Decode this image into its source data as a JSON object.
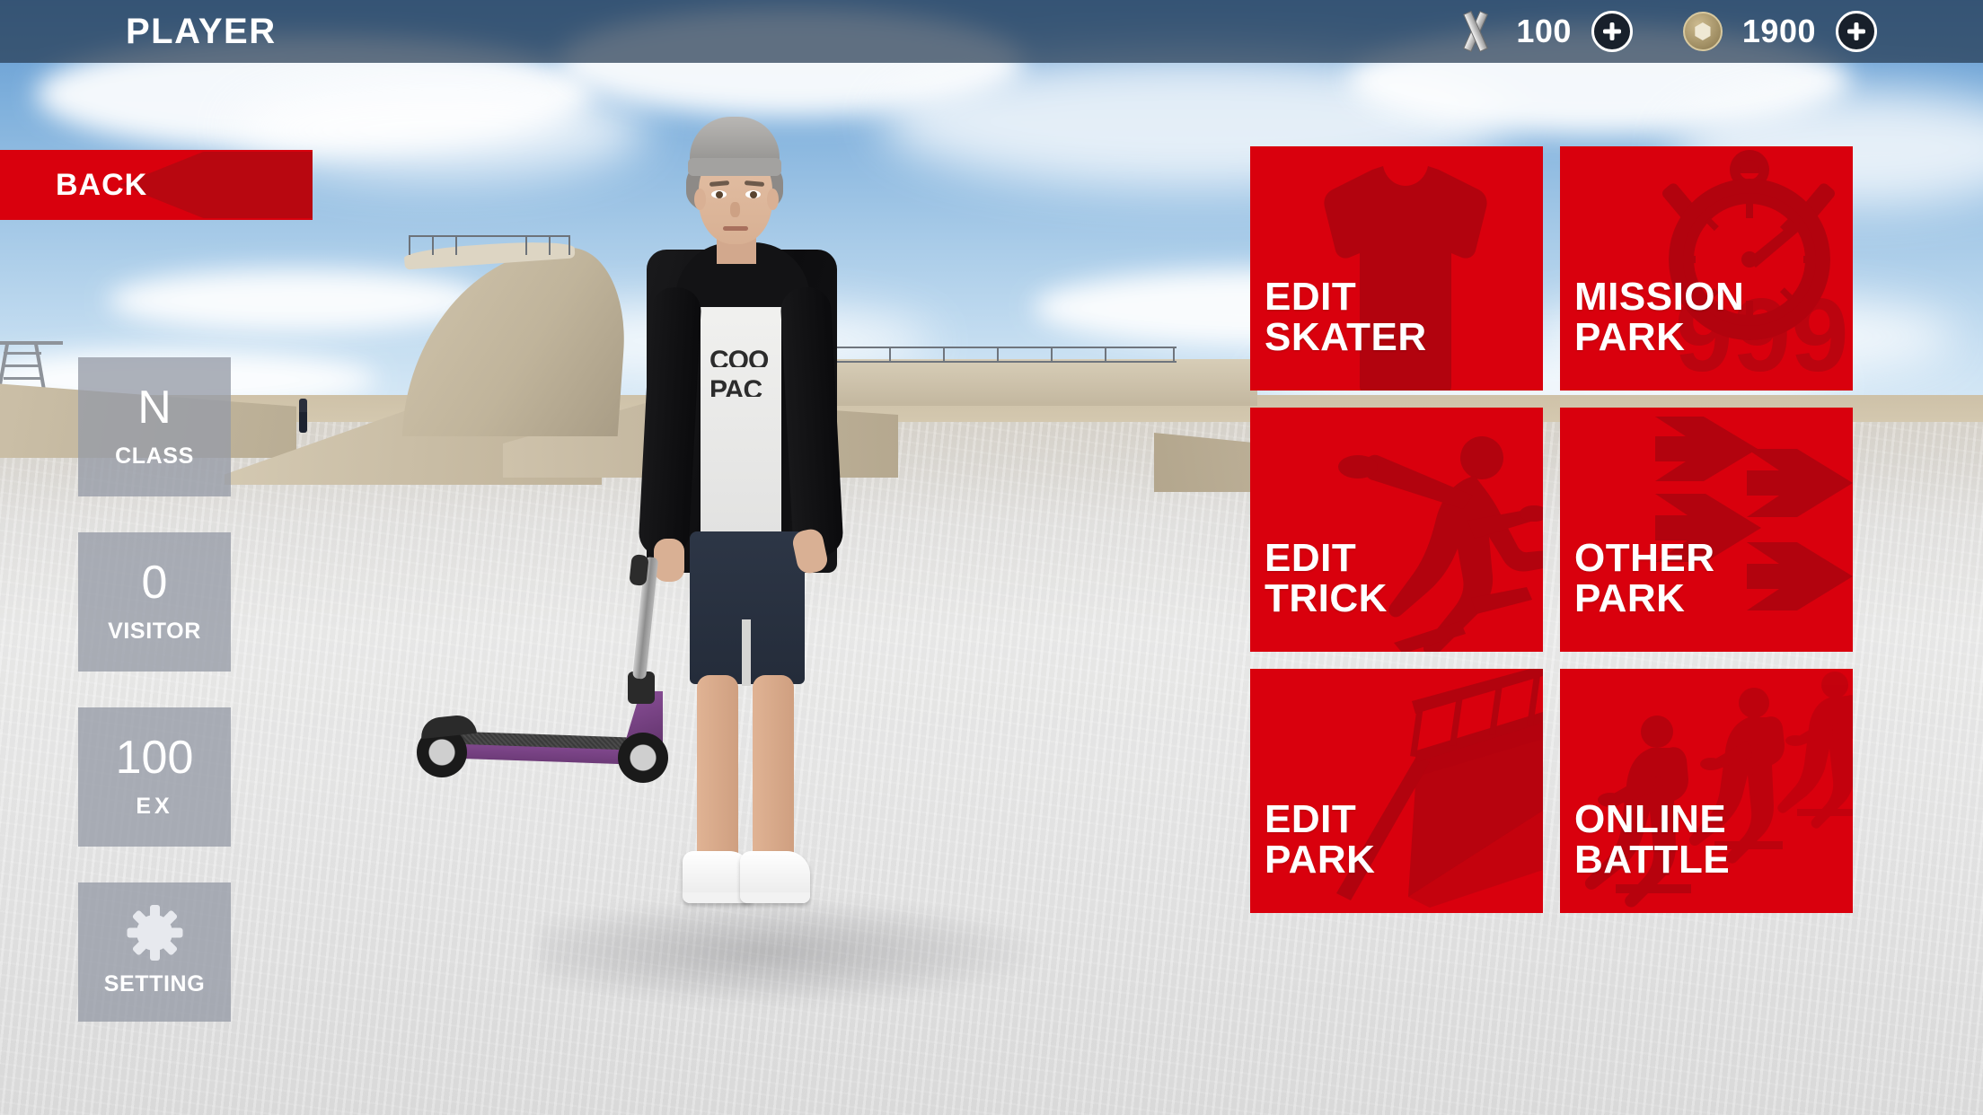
{
  "header": {
    "title": "PLAYER",
    "currencies": [
      {
        "icon": "x-token-icon",
        "value": "100",
        "add_label": "+"
      },
      {
        "icon": "gold-coin-icon",
        "value": "1900",
        "add_label": "+"
      }
    ]
  },
  "back_button": {
    "label": "BACK",
    "icon": "left-arrow-icon"
  },
  "stats": [
    {
      "value": "N",
      "caption": "CLASS",
      "spaced": false,
      "icon": null
    },
    {
      "value": "0",
      "caption": "VISITOR",
      "spaced": false,
      "icon": null
    },
    {
      "value": "100",
      "caption": "EX",
      "spaced": true,
      "icon": null
    },
    {
      "value": "",
      "caption": "SETTING",
      "spaced": false,
      "icon": "gear-icon"
    }
  ],
  "menu": {
    "tiles": [
      {
        "line1": "EDIT",
        "line2": "SKATER",
        "icon": "tshirt-icon"
      },
      {
        "line1": "MISSION",
        "line2": "PARK",
        "icon": "stopwatch-icon",
        "badge": "999"
      },
      {
        "line1": "EDIT",
        "line2": "TRICK",
        "icon": "skater-figure-icon"
      },
      {
        "line1": "OTHER",
        "line2": "PARK",
        "icon": "arrows-right-icon"
      },
      {
        "line1": "EDIT",
        "line2": "PARK",
        "icon": "ramp-icon"
      },
      {
        "line1": "ONLINE",
        "line2": "BATTLE",
        "icon": "scooter-riders-icon"
      }
    ]
  },
  "character": {
    "tshirt_text_line1": "COO",
    "tshirt_text_line2": "PAC"
  },
  "colors": {
    "tile_red": "#d9000d",
    "tile_watermark_red": "#b2030e",
    "back_red": "#d9000d",
    "back_arrow_red": "#b80710",
    "stat_panel": "rgba(150,155,166,0.78)",
    "topbar": "rgba(38,58,82,0.72)",
    "text_white": "#ffffff"
  }
}
